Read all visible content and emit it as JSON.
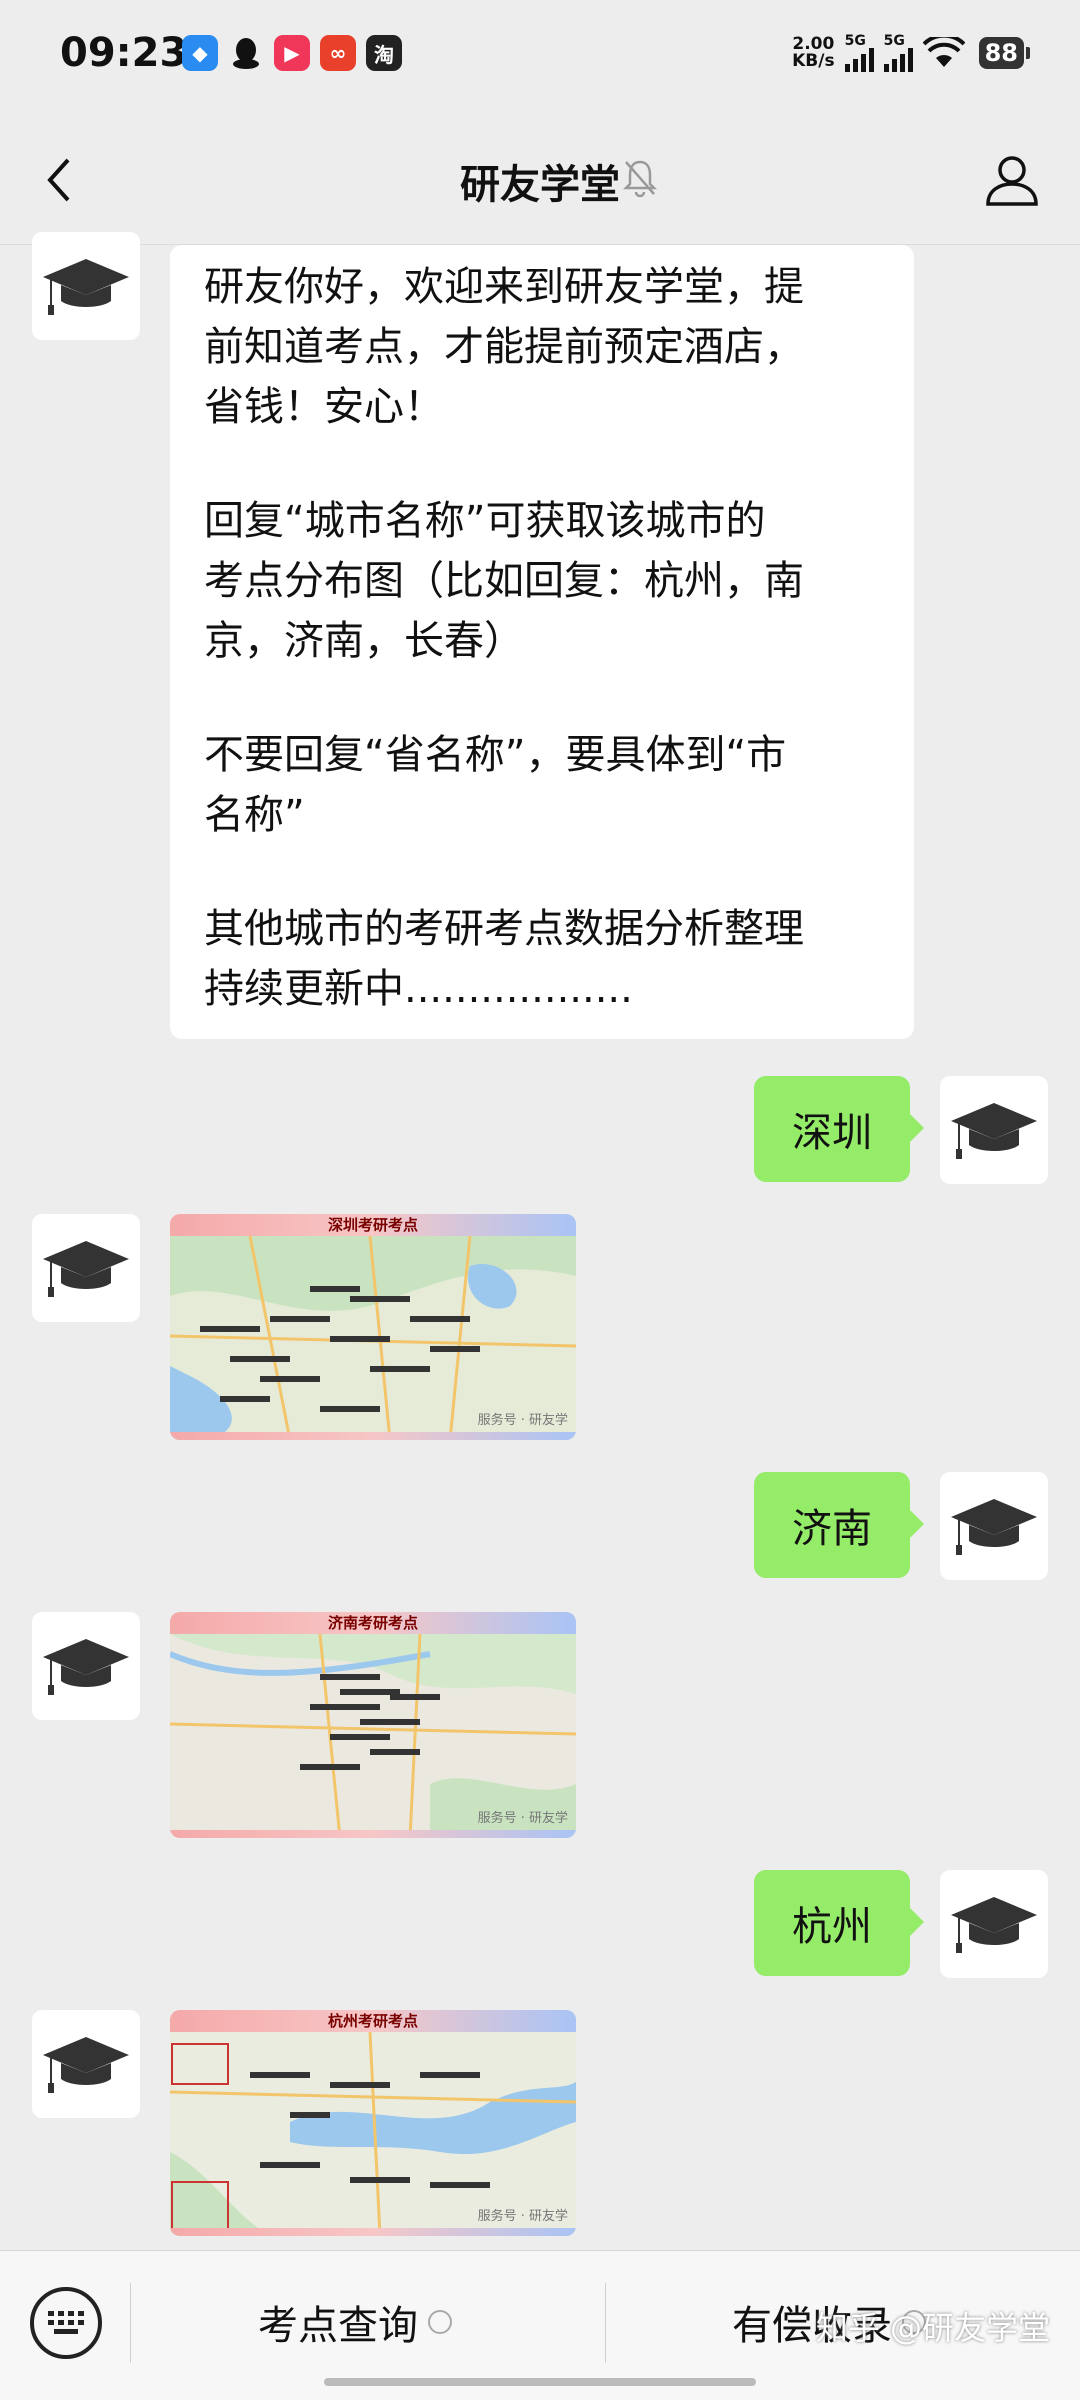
{
  "status_bar": {
    "time": "09:23",
    "net_speed_value": "2.00",
    "net_speed_unit": "KB/s",
    "signal_1": "5G",
    "signal_2": "5G",
    "battery": "88",
    "app_icons": [
      "browser-icon",
      "qq-icon",
      "video-icon",
      "pinduoduo-icon",
      "taobao-icon"
    ],
    "taobao_glyph": "淘"
  },
  "header": {
    "title": "研友学堂"
  },
  "messages": {
    "welcome": {
      "line1": "研友你好，欢迎来到研友学堂，提",
      "line2": "前知道考点，才能提前预定酒店，",
      "line3": "省钱！安心！",
      "line4": "回复“城市名称”可获取该城市的",
      "line5": "考点分布图（比如回复：杭州，南",
      "line6": "京，济南，长春）",
      "line7": "不要回复“省名称”，要具体到“市",
      "line8": "名称”",
      "line9": "其他城市的考研考点数据分析整理",
      "line10": "持续更新中.................."
    },
    "reply1": "深圳",
    "map1_title": "深圳考研考点",
    "reply2": "济南",
    "map2_title": "济南考研考点",
    "reply3": "杭州",
    "map3_title": "杭州考研考点",
    "map_watermark": "服务号 · 研友学"
  },
  "bottom_menu": {
    "item1": "考点查询",
    "item2": "有偿收录",
    "watermark": "知乎 @研友学堂"
  },
  "colors": {
    "sent_bubble": "#95ec69",
    "background": "#ededed"
  }
}
